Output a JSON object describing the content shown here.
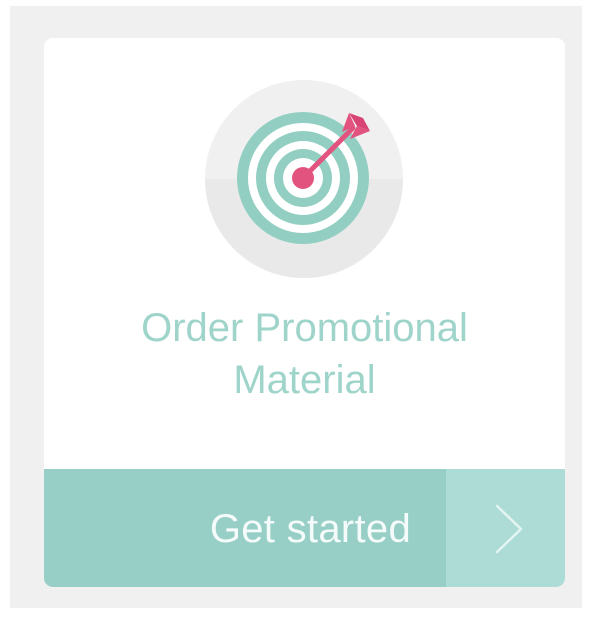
{
  "card": {
    "title_line1": "Order Promotional",
    "title_line2": "Material",
    "cta_label": "Get started",
    "icon": "target-arrow-icon",
    "arrow_icon": "chevron-right-icon"
  },
  "colors": {
    "page_background": "#f1f0f0",
    "card_background": "#ffffff",
    "accent_teal": "#9ed4c9",
    "cta_main": "#97cfc6",
    "cta_arrow_bg": "#acdcd5",
    "target_rings": "#92cfc2",
    "dart_pink": "#e2547f",
    "icon_circle": "#f0f0f0"
  }
}
